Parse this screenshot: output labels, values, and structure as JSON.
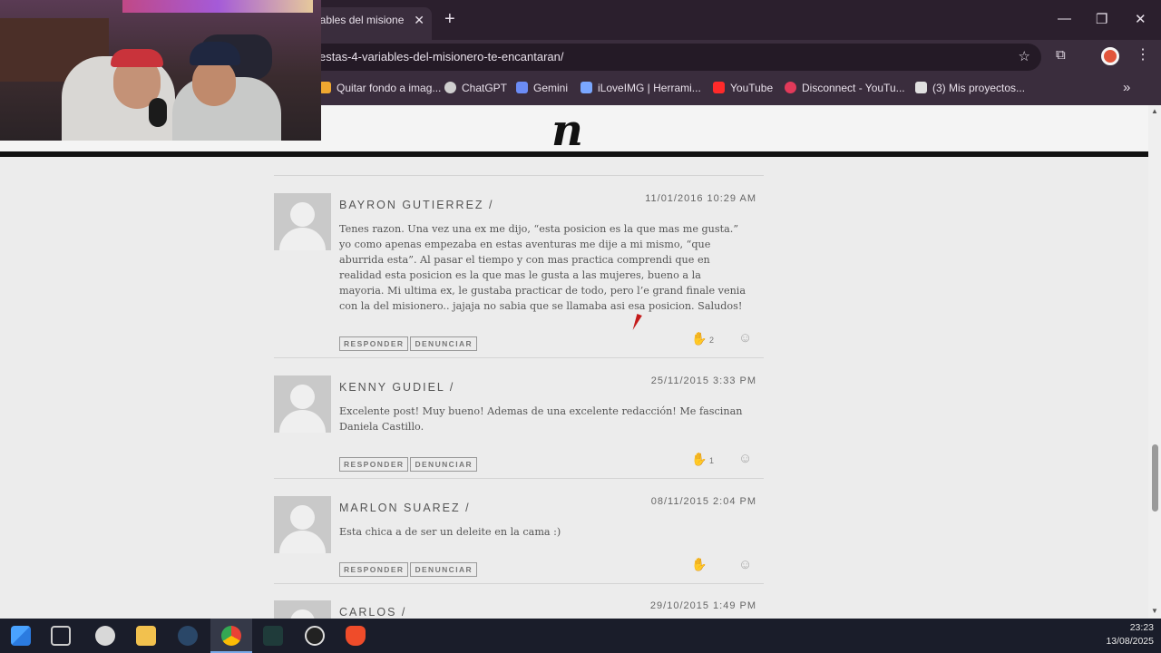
{
  "browser": {
    "tab_title": "iables del misione",
    "tab_close": "✕",
    "new_tab": "+",
    "address": "estas-4-variables-del-misionero-te-encantaran/",
    "minimize": "—",
    "restore": "❐",
    "close": "✕",
    "bookmarks": [
      {
        "label": "Quitar fondo a imag...",
        "color": "#f0a830"
      },
      {
        "label": "ChatGPT",
        "color": "#cfcfcf"
      },
      {
        "label": "Gemini",
        "color": "#6b8cf5"
      },
      {
        "label": "iLoveIMG | Herrami...",
        "color": "#7aa7ff"
      },
      {
        "label": "YouTube",
        "color": "#ff2a2a"
      },
      {
        "label": "Disconnect - YouTu...",
        "color": "#e23a5a"
      },
      {
        "label": "(3)  Mis proyectos...",
        "color": "#e0e0e0"
      }
    ],
    "more": "»"
  },
  "site": {
    "logo": "n"
  },
  "comments": [
    {
      "author": "BAYRON GUTIERREZ /",
      "date": "11/01/2016 10:29 AM",
      "text": "Tenes razon. Una vez una ex me dijo, “esta posicion es la que mas me gusta.” yo como apenas empezaba en estas aventuras me dije a mi mismo, “que aburrida esta”. Al pasar el tiempo y con mas practica comprendi que en realidad esta posicion es la que mas le gusta a las mujeres, bueno a la mayoria. Mi ultima ex, le gustaba practicar de todo, pero l’e grand finale venia con la del misionero.. jajaja no sabia que se llamaba asi esa posicion. Saludos!",
      "reply": "RESPONDER",
      "report": "DENUNCIAR",
      "likes": "2"
    },
    {
      "author": "KENNY GUDIEL /",
      "date": "25/11/2015 3:33 PM",
      "text": "Excelente post! Muy bueno! Ademas de una excelente redacción! Me fascinan Daniela Castillo.",
      "reply": "RESPONDER",
      "report": "DENUNCIAR",
      "likes": "1"
    },
    {
      "author": "MARLON SUAREZ /",
      "date": "08/11/2015 2:04 PM",
      "text": "Esta chica a de ser un deleite en la cama :)",
      "reply": "RESPONDER",
      "report": "DENUNCIAR",
      "likes": ""
    },
    {
      "author": "CARLOS /",
      "date": "29/10/2015 1:49 PM"
    }
  ],
  "icons": {
    "like": "✋",
    "smiley": "☺",
    "star": "☆",
    "extensions": "⧉",
    "menu": "⋮"
  },
  "taskbar": {
    "time": "23:23",
    "date": "13/08/2025"
  }
}
